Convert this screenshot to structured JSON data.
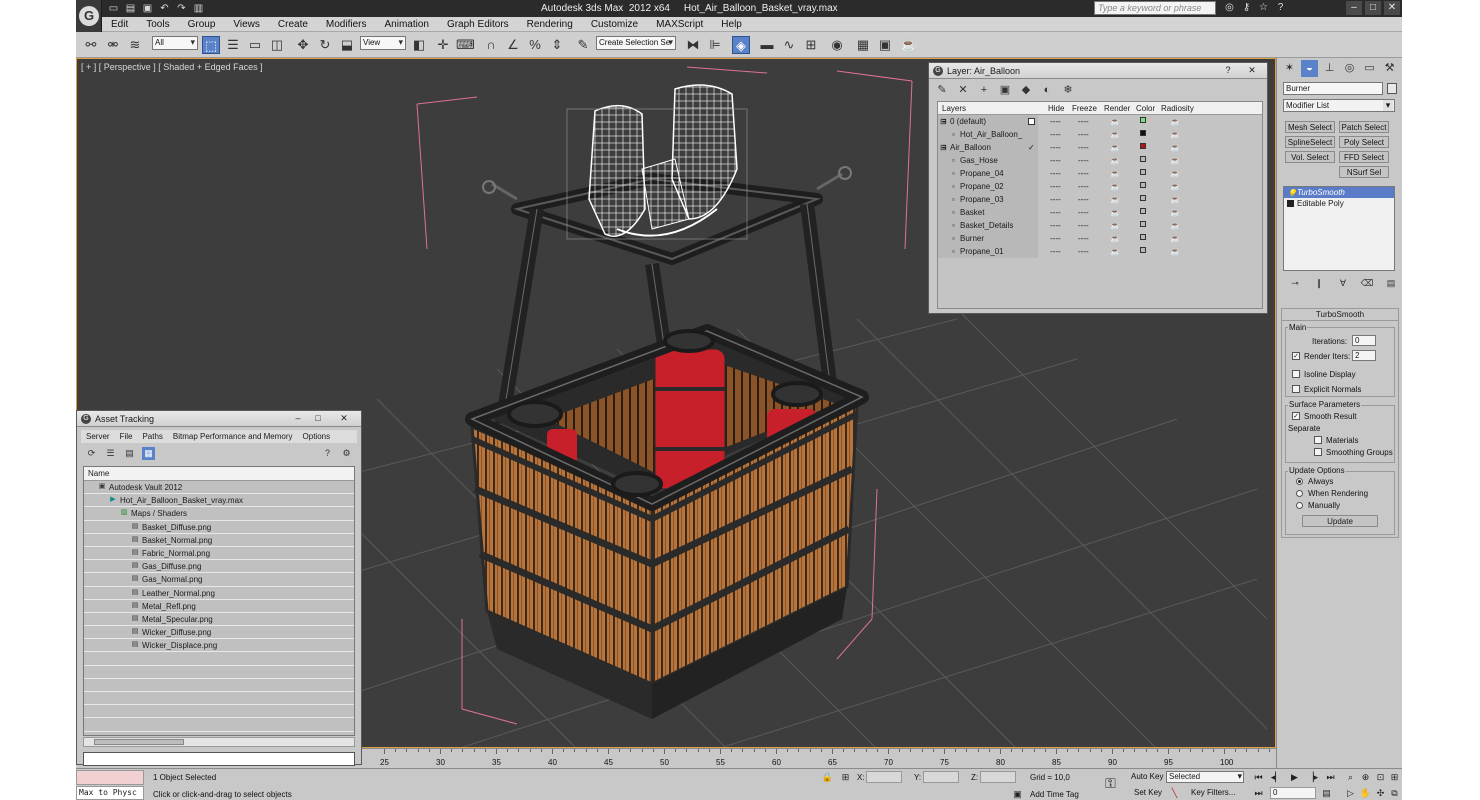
{
  "window": {
    "title": "Autodesk 3ds Max  2012 x64     Hot_Air_Balloon_Basket_vray.max",
    "search_placeholder": "Type a keyword or phrase"
  },
  "menu": [
    "Edit",
    "Tools",
    "Group",
    "Views",
    "Create",
    "Modifiers",
    "Animation",
    "Graph Editors",
    "Rendering",
    "Customize",
    "MAXScript",
    "Help"
  ],
  "toolbar": {
    "selection_filter": "All",
    "ref_coord": "View",
    "named_selection": "Create Selection Se"
  },
  "viewport": {
    "label": "[ + ] [ Perspective ] [ Shaded + Edged Faces ]"
  },
  "layer_window": {
    "title": "Layer: Air_Balloon",
    "columns": [
      "Layers",
      "Hide",
      "Freeze",
      "Render",
      "Color",
      "Radiosity"
    ],
    "rows": [
      {
        "name": "0 (default)",
        "indent": 0,
        "color": "#7be07b",
        "checkbox": true
      },
      {
        "name": "Hot_Air_Balloon_",
        "indent": 1,
        "color": "#111111"
      },
      {
        "name": "Air_Balloon",
        "indent": 0,
        "color": "#b01818",
        "check": "✓"
      },
      {
        "name": "Gas_Hose",
        "indent": 1,
        "color": "#b8b8b8"
      },
      {
        "name": "Propane_04",
        "indent": 1,
        "color": "#b8b8b8"
      },
      {
        "name": "Propane_02",
        "indent": 1,
        "color": "#b8b8b8"
      },
      {
        "name": "Propane_03",
        "indent": 1,
        "color": "#b8b8b8"
      },
      {
        "name": "Basket",
        "indent": 1,
        "color": "#b8b8b8"
      },
      {
        "name": "Basket_Details",
        "indent": 1,
        "color": "#b8b8b8"
      },
      {
        "name": "Burner",
        "indent": 1,
        "color": "#b8b8b8"
      },
      {
        "name": "Propane_01",
        "indent": 1,
        "color": "#b8b8b8"
      }
    ]
  },
  "asset_tracking": {
    "title": "Asset Tracking",
    "menu": [
      "Server",
      "File",
      "Paths",
      "Bitmap Performance and Memory",
      "Options"
    ],
    "column": "Name",
    "items": [
      {
        "label": "Autodesk Vault 2012",
        "level": 0
      },
      {
        "label": "Hot_Air_Balloon_Basket_vray.max",
        "level": 1
      },
      {
        "label": "Maps / Shaders",
        "level": 2
      },
      {
        "label": "Basket_Diffuse.png",
        "level": 3
      },
      {
        "label": "Basket_Normal.png",
        "level": 3
      },
      {
        "label": "Fabric_Normal.png",
        "level": 3
      },
      {
        "label": "Gas_Diffuse.png",
        "level": 3
      },
      {
        "label": "Gas_Normal.png",
        "level": 3
      },
      {
        "label": "Leather_Normal.png",
        "level": 3
      },
      {
        "label": "Metal_Refl.png",
        "level": 3
      },
      {
        "label": "Metal_Specular.png",
        "level": 3
      },
      {
        "label": "Wicker_Diffuse.png",
        "level": 3
      },
      {
        "label": "Wicker_Displace.png",
        "level": 3
      }
    ]
  },
  "command_panel": {
    "object_name": "Burner",
    "modifier_list": "Modifier List",
    "buttons": [
      "Mesh Select",
      "Patch Select",
      "SplineSelect",
      "Poly Select",
      "Vol. Select",
      "FFD Select",
      "NSurf Sel"
    ],
    "stack": [
      {
        "label": "TurboSmooth",
        "selected": true
      },
      {
        "label": "Editable Poly",
        "selected": false
      }
    ],
    "rollout": {
      "title": "TurboSmooth",
      "main": "Main",
      "iterations_label": "Iterations:",
      "iterations": "0",
      "render_iters_label": "Render Iters:",
      "render_iters": "2",
      "isoline": "Isoline Display",
      "explicit": "Explicit Normals",
      "surface": "Surface Parameters",
      "smooth_result": "Smooth Result",
      "separate": "Separate",
      "materials": "Materials",
      "smoothing_groups": "Smoothing Groups",
      "update_options": "Update Options",
      "always": "Always",
      "when_rendering": "When Rendering",
      "manually": "Manually",
      "update_btn": "Update"
    }
  },
  "timeline": {
    "ticks": [
      "25",
      "30",
      "35",
      "40",
      "45",
      "50",
      "55",
      "60",
      "65",
      "70",
      "75",
      "80",
      "85",
      "90",
      "95",
      "100"
    ]
  },
  "status": {
    "listener": "Max to Physc",
    "selected": "1 Object Selected",
    "prompt": "Click or click-and-drag to select objects",
    "x_label": "X:",
    "y_label": "Y:",
    "z_label": "Z:",
    "grid": "Grid = 10,0",
    "add_time_tag": "Add Time Tag",
    "auto_key": "Auto Key",
    "auto_key_mode": "Selected",
    "set_key": "Set Key",
    "key_filters": "Key Filters...",
    "frame": "0"
  },
  "colors": {
    "accent": "#5a82c8",
    "viewport_bg": "#3d3d3d",
    "wicker": "#b8743a",
    "propane": "#c8202a",
    "frame": "#2a2a2a"
  }
}
